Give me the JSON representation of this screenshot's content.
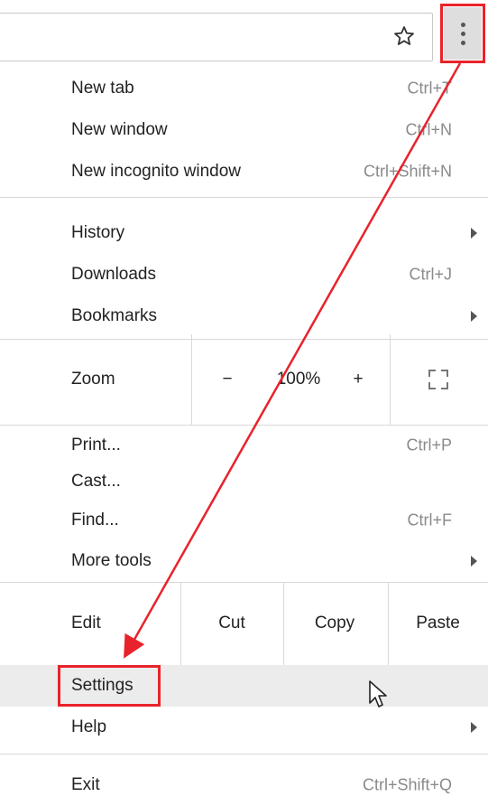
{
  "menu": {
    "new_tab": {
      "label": "New tab",
      "shortcut": "Ctrl+T"
    },
    "new_window": {
      "label": "New window",
      "shortcut": "Ctrl+N"
    },
    "new_incognito": {
      "label": "New incognito window",
      "shortcut": "Ctrl+Shift+N"
    },
    "history": {
      "label": "History"
    },
    "downloads": {
      "label": "Downloads",
      "shortcut": "Ctrl+J"
    },
    "bookmarks": {
      "label": "Bookmarks"
    },
    "zoom": {
      "label": "Zoom",
      "minus": "−",
      "level": "100%",
      "plus": "+"
    },
    "print": {
      "label": "Print...",
      "shortcut": "Ctrl+P"
    },
    "cast": {
      "label": "Cast..."
    },
    "find": {
      "label": "Find...",
      "shortcut": "Ctrl+F"
    },
    "more_tools": {
      "label": "More tools"
    },
    "edit": {
      "label": "Edit",
      "cut": "Cut",
      "copy": "Copy",
      "paste": "Paste"
    },
    "settings": {
      "label": "Settings"
    },
    "help": {
      "label": "Help"
    },
    "exit": {
      "label": "Exit",
      "shortcut": "Ctrl+Shift+Q"
    }
  },
  "icons": {
    "bookmark_star": "star-outline",
    "menu": "three-vertical-dots",
    "fullscreen": "fullscreen-corners",
    "submenu_arrow": "triangle-right"
  },
  "colors": {
    "annotation": "#e8232b",
    "highlight_row": "#ececec",
    "shortcut_text": "#8a8a8a"
  }
}
